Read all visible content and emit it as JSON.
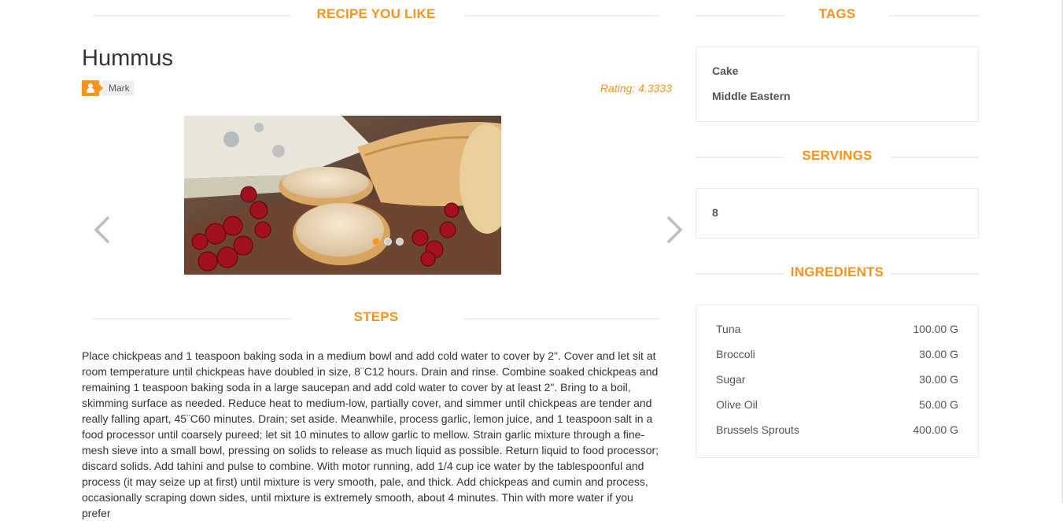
{
  "sections": {
    "recipe": "RECIPE YOU LIKE",
    "tags": "TAGS",
    "servings": "SERVINGS",
    "ingredients": "INGREDIENTS",
    "steps": "STEPS"
  },
  "recipe": {
    "title": "Hummus",
    "author": "Mark",
    "rating": "Rating: 4.3333"
  },
  "carousel": {
    "image_alt": "bread, cheese and red currants",
    "slide_count": 3,
    "active_slide": 1
  },
  "steps_text": "Place chickpeas and 1 teaspoon baking soda in a medium bowl and add cold water to cover by 2\". Cover and let sit at room temperature until chickpeas have doubled in size, 8¨C12 hours. Drain and rinse. Combine soaked chickpeas and remaining 1 teaspoon baking soda in a large saucepan and add cold water to cover by at least 2\". Bring to a boil, skimming surface as needed. Reduce heat to medium-low, partially cover, and simmer until chickpeas are tender and really falling apart, 45¨C60 minutes. Drain; set aside. Meanwhile, process garlic, lemon juice, and 1 teaspoon salt in a food processor until coarsely pureed; let sit 10 minutes to allow garlic to mellow. Strain garlic mixture through a fine-mesh sieve into a small bowl, pressing on solids to release as much liquid as possible. Return liquid to food processor; discard solids. Add tahini and pulse to combine. With motor running, add 1/4 cup ice water by the tablespoonful and process (it may seize up at first) until mixture is very smooth, pale, and thick. Add chickpeas and cumin and process, occasionally scraping down sides, until mixture is extremely smooth, about 4 minutes. Thin with more water if you prefer",
  "tags": [
    "Cake",
    "Middle Eastern"
  ],
  "servings": "8",
  "ingredients": [
    {
      "name": "Tuna",
      "qty": "100.00 G"
    },
    {
      "name": "Broccoli",
      "qty": "30.00 G"
    },
    {
      "name": "Sugar",
      "qty": "30.00 G"
    },
    {
      "name": "Olive Oil",
      "qty": "50.00 G"
    },
    {
      "name": "Brussels Sprouts",
      "qty": "400.00 G"
    }
  ],
  "colors": {
    "accent": "#f7941d",
    "text": "#333333",
    "muted": "#555555",
    "border": "#ececec"
  },
  "icons": {
    "author": "user-icon",
    "prev": "chevron-left-icon",
    "next": "chevron-right-icon"
  }
}
